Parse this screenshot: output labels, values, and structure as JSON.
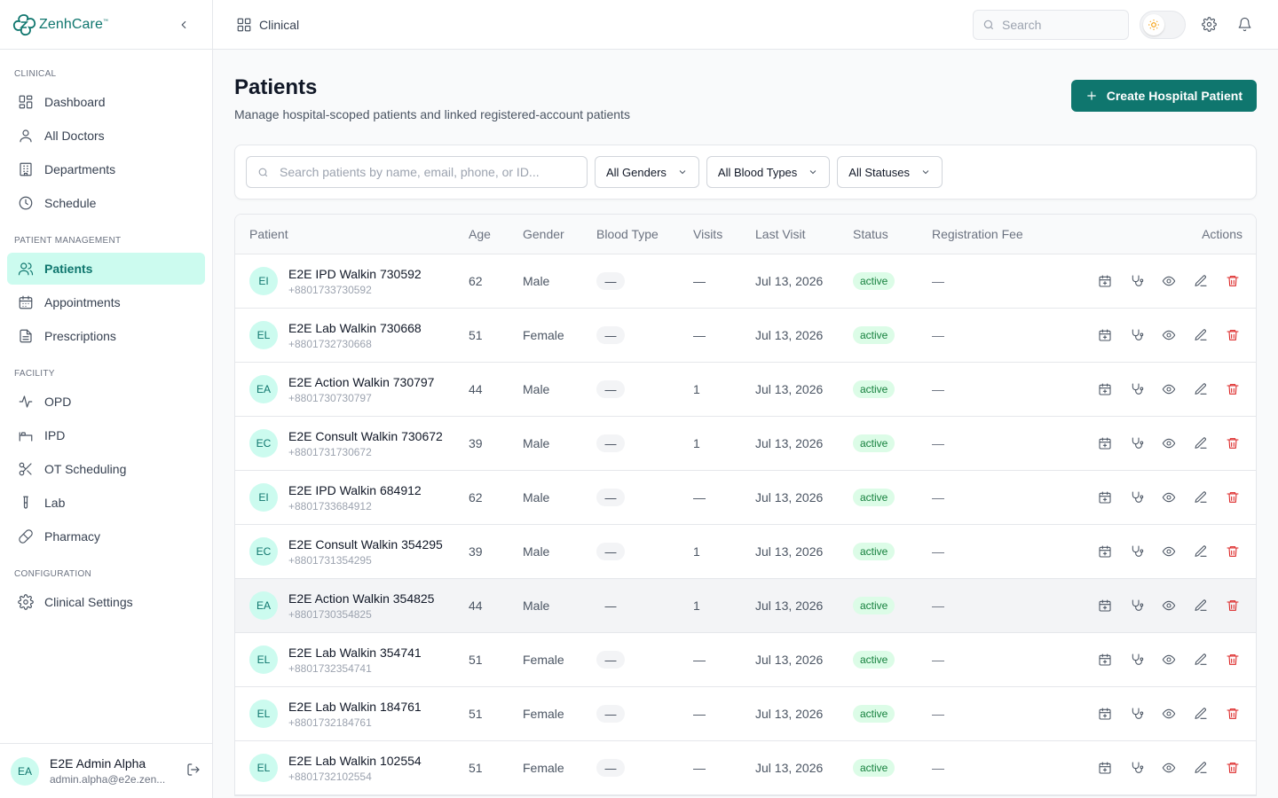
{
  "brand": {
    "name": "ZenhCare",
    "tm": "™"
  },
  "sidebar": {
    "sections": [
      {
        "label": "CLINICAL",
        "items": [
          {
            "label": "Dashboard",
            "icon": "dashboard-icon"
          },
          {
            "label": "All Doctors",
            "icon": "user-icon"
          },
          {
            "label": "Departments",
            "icon": "building-icon"
          },
          {
            "label": "Schedule",
            "icon": "clock-icon"
          }
        ]
      },
      {
        "label": "PATIENT MANAGEMENT",
        "items": [
          {
            "label": "Patients",
            "icon": "users-icon",
            "active": true
          },
          {
            "label": "Appointments",
            "icon": "calendar-icon"
          },
          {
            "label": "Prescriptions",
            "icon": "document-icon"
          }
        ]
      },
      {
        "label": "FACILITY",
        "items": [
          {
            "label": "OPD",
            "icon": "activity-icon"
          },
          {
            "label": "IPD",
            "icon": "bed-icon"
          },
          {
            "label": "OT Scheduling",
            "icon": "scissors-icon"
          },
          {
            "label": "Lab",
            "icon": "test-tube-icon"
          },
          {
            "label": "Pharmacy",
            "icon": "pill-icon"
          }
        ]
      },
      {
        "label": "CONFIGURATION",
        "items": [
          {
            "label": "Clinical Settings",
            "icon": "gear-icon"
          }
        ]
      }
    ],
    "user": {
      "initials": "EA",
      "name": "E2E Admin Alpha",
      "email": "admin.alpha@e2e.zen..."
    }
  },
  "topbar": {
    "breadcrumb": "Clinical",
    "search_placeholder": "Search"
  },
  "page": {
    "title": "Patients",
    "subtitle": "Manage hospital-scoped patients and linked registered-account patients",
    "create_label": "Create Hospital Patient"
  },
  "filters": {
    "search_placeholder": "Search patients by name, email, phone, or ID...",
    "gender": "All Genders",
    "blood": "All Blood Types",
    "status": "All Statuses"
  },
  "table": {
    "headers": {
      "patient": "Patient",
      "age": "Age",
      "gender": "Gender",
      "blood": "Blood Type",
      "visits": "Visits",
      "last_visit": "Last Visit",
      "status": "Status",
      "fee": "Registration Fee",
      "actions": "Actions"
    },
    "rows": [
      {
        "initials": "EI",
        "name": "E2E IPD Walkin 730592",
        "phone": "+8801733730592",
        "age": "62",
        "gender": "Male",
        "blood": "—",
        "visits": "—",
        "last_visit": "Jul 13, 2026",
        "status": "active",
        "fee": "—"
      },
      {
        "initials": "EL",
        "name": "E2E Lab Walkin 730668",
        "phone": "+8801732730668",
        "age": "51",
        "gender": "Female",
        "blood": "—",
        "visits": "—",
        "last_visit": "Jul 13, 2026",
        "status": "active",
        "fee": "—"
      },
      {
        "initials": "EA",
        "name": "E2E Action Walkin 730797",
        "phone": "+8801730730797",
        "age": "44",
        "gender": "Male",
        "blood": "—",
        "visits": "1",
        "last_visit": "Jul 13, 2026",
        "status": "active",
        "fee": "—"
      },
      {
        "initials": "EC",
        "name": "E2E Consult Walkin 730672",
        "phone": "+8801731730672",
        "age": "39",
        "gender": "Male",
        "blood": "—",
        "visits": "1",
        "last_visit": "Jul 13, 2026",
        "status": "active",
        "fee": "—"
      },
      {
        "initials": "EI",
        "name": "E2E IPD Walkin 684912",
        "phone": "+8801733684912",
        "age": "62",
        "gender": "Male",
        "blood": "—",
        "visits": "—",
        "last_visit": "Jul 13, 2026",
        "status": "active",
        "fee": "—"
      },
      {
        "initials": "EC",
        "name": "E2E Consult Walkin 354295",
        "phone": "+8801731354295",
        "age": "39",
        "gender": "Male",
        "blood": "—",
        "visits": "1",
        "last_visit": "Jul 13, 2026",
        "status": "active",
        "fee": "—"
      },
      {
        "initials": "EA",
        "name": "E2E Action Walkin 354825",
        "phone": "+8801730354825",
        "age": "44",
        "gender": "Male",
        "blood": "—",
        "visits": "1",
        "last_visit": "Jul 13, 2026",
        "status": "active",
        "fee": "—",
        "hover": true
      },
      {
        "initials": "EL",
        "name": "E2E Lab Walkin 354741",
        "phone": "+8801732354741",
        "age": "51",
        "gender": "Female",
        "blood": "—",
        "visits": "—",
        "last_visit": "Jul 13, 2026",
        "status": "active",
        "fee": "—"
      },
      {
        "initials": "EL",
        "name": "E2E Lab Walkin 184761",
        "phone": "+8801732184761",
        "age": "51",
        "gender": "Female",
        "blood": "—",
        "visits": "—",
        "last_visit": "Jul 13, 2026",
        "status": "active",
        "fee": "—"
      },
      {
        "initials": "EL",
        "name": "E2E Lab Walkin 102554",
        "phone": "+8801732102554",
        "age": "51",
        "gender": "Female",
        "blood": "—",
        "visits": "—",
        "last_visit": "Jul 13, 2026",
        "status": "active",
        "fee": "—"
      }
    ]
  },
  "colors": {
    "accent": "#0f766e",
    "accent_light": "#ccfbef",
    "status_bg": "#dcfce7",
    "status_text": "#15803d",
    "danger": "#dc2626"
  }
}
